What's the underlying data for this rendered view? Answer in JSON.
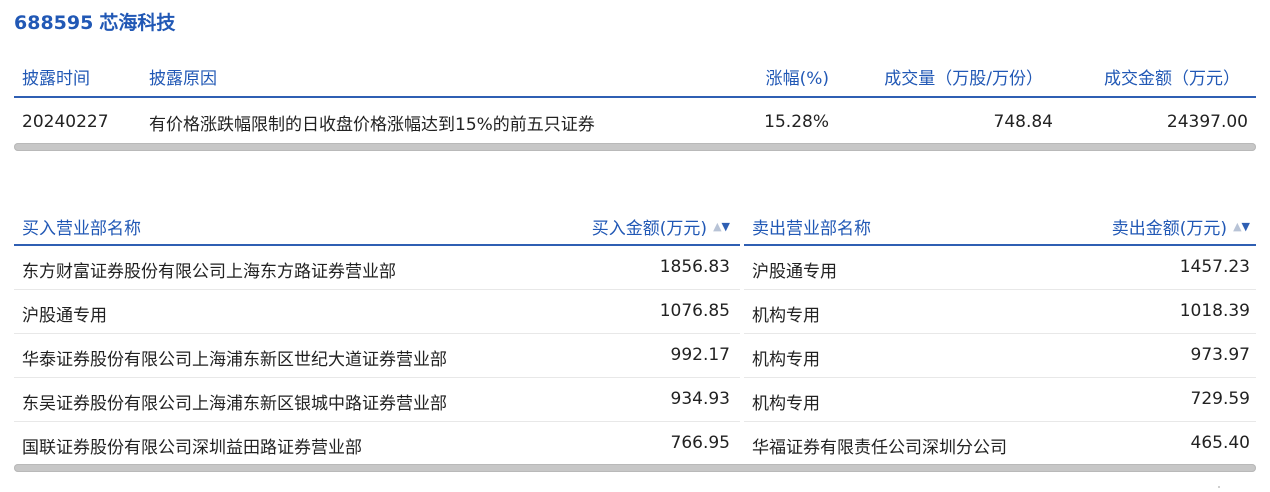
{
  "stock": {
    "code": "688595",
    "name": "芯海科技"
  },
  "disclosure": {
    "headers": {
      "date": "披露时间",
      "reason": "披露原因",
      "change": "涨幅(%)",
      "volume": "成交量（万股/万份）",
      "amount": "成交金额（万元）"
    },
    "rows": [
      {
        "date": "20240227",
        "reason": "有价格涨跌幅限制的日收盘价格涨幅达到15%的前五只证券",
        "change": "15.28%",
        "volume": "748.84",
        "amount": "24397.00"
      }
    ]
  },
  "buy": {
    "headers": {
      "name": "买入营业部名称",
      "amount": "买入金额(万元)"
    },
    "rows": [
      {
        "name": "东方财富证券股份有限公司上海东方路证券营业部",
        "amount": "1856.83"
      },
      {
        "name": "沪股通专用",
        "amount": "1076.85"
      },
      {
        "name": "华泰证券股份有限公司上海浦东新区世纪大道证券营业部",
        "amount": "992.17"
      },
      {
        "name": "东吴证券股份有限公司上海浦东新区银城中路证券营业部",
        "amount": "934.93"
      },
      {
        "name": "国联证券股份有限公司深圳益田路证券营业部",
        "amount": "766.95"
      }
    ]
  },
  "sell": {
    "headers": {
      "name": "卖出营业部名称",
      "amount": "卖出金额(万元)"
    },
    "rows": [
      {
        "name": "沪股通专用",
        "amount": "1457.23"
      },
      {
        "name": "机构专用",
        "amount": "1018.39"
      },
      {
        "name": "机构专用",
        "amount": "973.97"
      },
      {
        "name": "机构专用",
        "amount": "729.59"
      },
      {
        "name": "华福证券有限责任公司深圳分公司",
        "amount": "465.40"
      }
    ]
  },
  "icons": {
    "sort": "sort-toggle-icon"
  },
  "colors": {
    "accent": "#2158b5",
    "rule": "#2f5fb3",
    "scrollbar": "#c7c7c7"
  }
}
